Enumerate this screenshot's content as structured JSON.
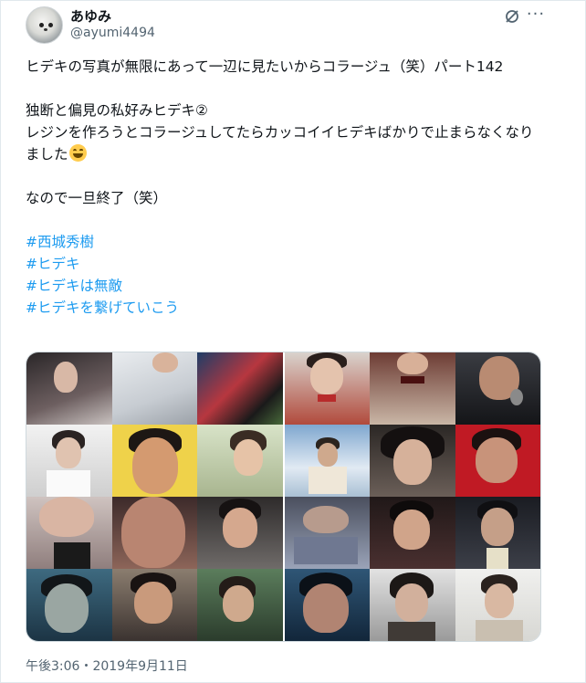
{
  "user": {
    "display_name": "あゆみ",
    "handle": "@ayumi4494"
  },
  "tweet": {
    "lines": [
      "ヒデキの写真が無限にあって一辺に見たいからコラージュ（笑）パート142",
      "",
      "独断と偏見の私好みヒデキ②",
      "レジンを作ろうとコラージュしてたらカッコイイヒデキばかりで止まらなくなりました",
      "",
      "なので一旦終了（笑）",
      ""
    ],
    "hashtags": [
      "#西城秀樹",
      "#ヒデキ",
      "#ヒデキは無敵",
      "#ヒデキを繋げていこう"
    ],
    "timestamp": "午後3:06・2019年9月11日"
  },
  "icons": {
    "grok": "grok-icon",
    "more": "more-options-icon",
    "emoji": "grinning-squinting-face-icon"
  },
  "colors": {
    "hashtag": "#1d9bf0",
    "secondary_text": "#536471",
    "primary_text": "#0f1419"
  }
}
